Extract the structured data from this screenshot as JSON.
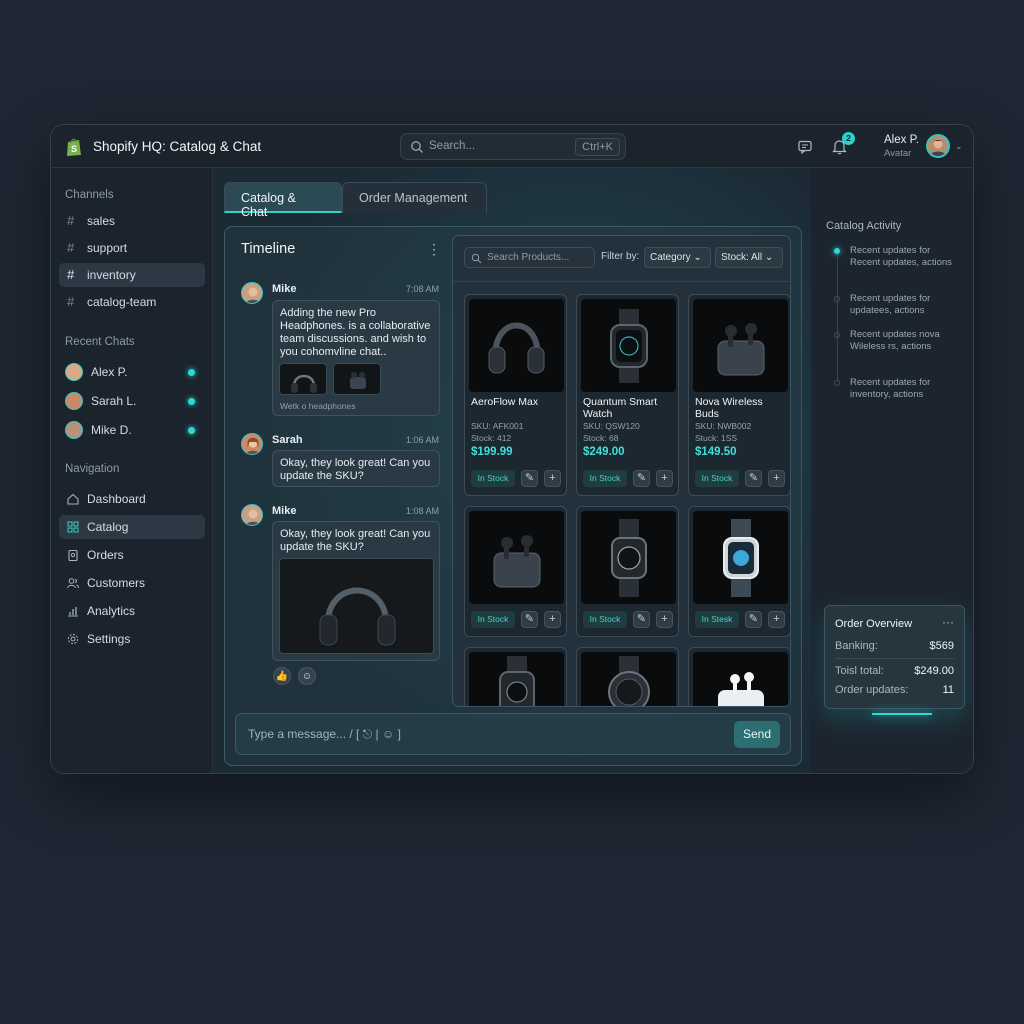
{
  "app": {
    "title": "Shopify HQ: Catalog & Chat"
  },
  "search": {
    "placeholder": "Search...",
    "shortcut": "Ctrl+K"
  },
  "notifications": {
    "count": "2"
  },
  "user": {
    "name": "Alex P.",
    "subtitle": "Avatar"
  },
  "sidebar": {
    "channels_label": "Channels",
    "channels": [
      "sales",
      "support",
      "inventory",
      "catalog-team"
    ],
    "recent_label": "Recent Chats",
    "recent": [
      "Alex P.",
      "Sarah L.",
      "Mike D."
    ],
    "nav_label": "Navigation",
    "nav": [
      "Dashboard",
      "Catalog",
      "Orders",
      "Customers",
      "Analytics",
      "Settings"
    ]
  },
  "tabs": [
    "Catalog & Chat",
    "Order Management"
  ],
  "timeline": {
    "title": "Timeline",
    "messages": [
      {
        "name": "Mike",
        "time": "7:08 AM",
        "text": "Adding the new Pro Headphones. is a collaborative team discussions. and wish to you cohomvline chat..",
        "caption": "Wetk o headphones"
      },
      {
        "name": "Sarah",
        "time": "1:06 AM",
        "text": "Okay, they look great! Can you update the SKU?"
      },
      {
        "name": "Mike",
        "time": "1:08 AM",
        "text": "Okay, they look great! Can you update the SKU?"
      }
    ],
    "reactions": [
      "👍",
      "☺"
    ]
  },
  "composer": {
    "placeholder": "Type a message... / [ ⎋ | ☺ ]",
    "send": "Send"
  },
  "products": {
    "search_placeholder": "Search Products...",
    "filter_label": "Filter by:",
    "category": "Category",
    "stock": "Stock: All",
    "stock_badge": "In Stock",
    "stock_badge_alt": "In Stesk",
    "items": [
      {
        "name": "AeroFlow Max",
        "sku": "SKU: AFK001",
        "stock": "Stock: 412",
        "price": "$199.99"
      },
      {
        "name": "Quantum Smart Watch",
        "sku": "SKU: QSW120",
        "stock": "Stock: 68",
        "price": "$249.00"
      },
      {
        "name": "Nova Wireless Buds",
        "sku": "SKU: NWB002",
        "stock": "Stuck: 1SS",
        "price": "$149.50"
      }
    ]
  },
  "activity": {
    "title": "Catalog Activity",
    "items": [
      "Recent updates for Recent updates, actions",
      "Recent updates for updatees, actions",
      "Recent updates nova Wileless rs, actions",
      "Recent updates for inventory, actions"
    ]
  },
  "order_overview": {
    "title": "Order Overview",
    "rows": [
      {
        "label": "Banking:",
        "value": "$569"
      },
      {
        "label": "Toisl total:",
        "value": "$249.00"
      },
      {
        "label": "Order updates:",
        "value": "11"
      }
    ]
  },
  "colors": {
    "accent": "#2fd8d4",
    "background": "#1e2733",
    "panel": "#1c252f"
  }
}
